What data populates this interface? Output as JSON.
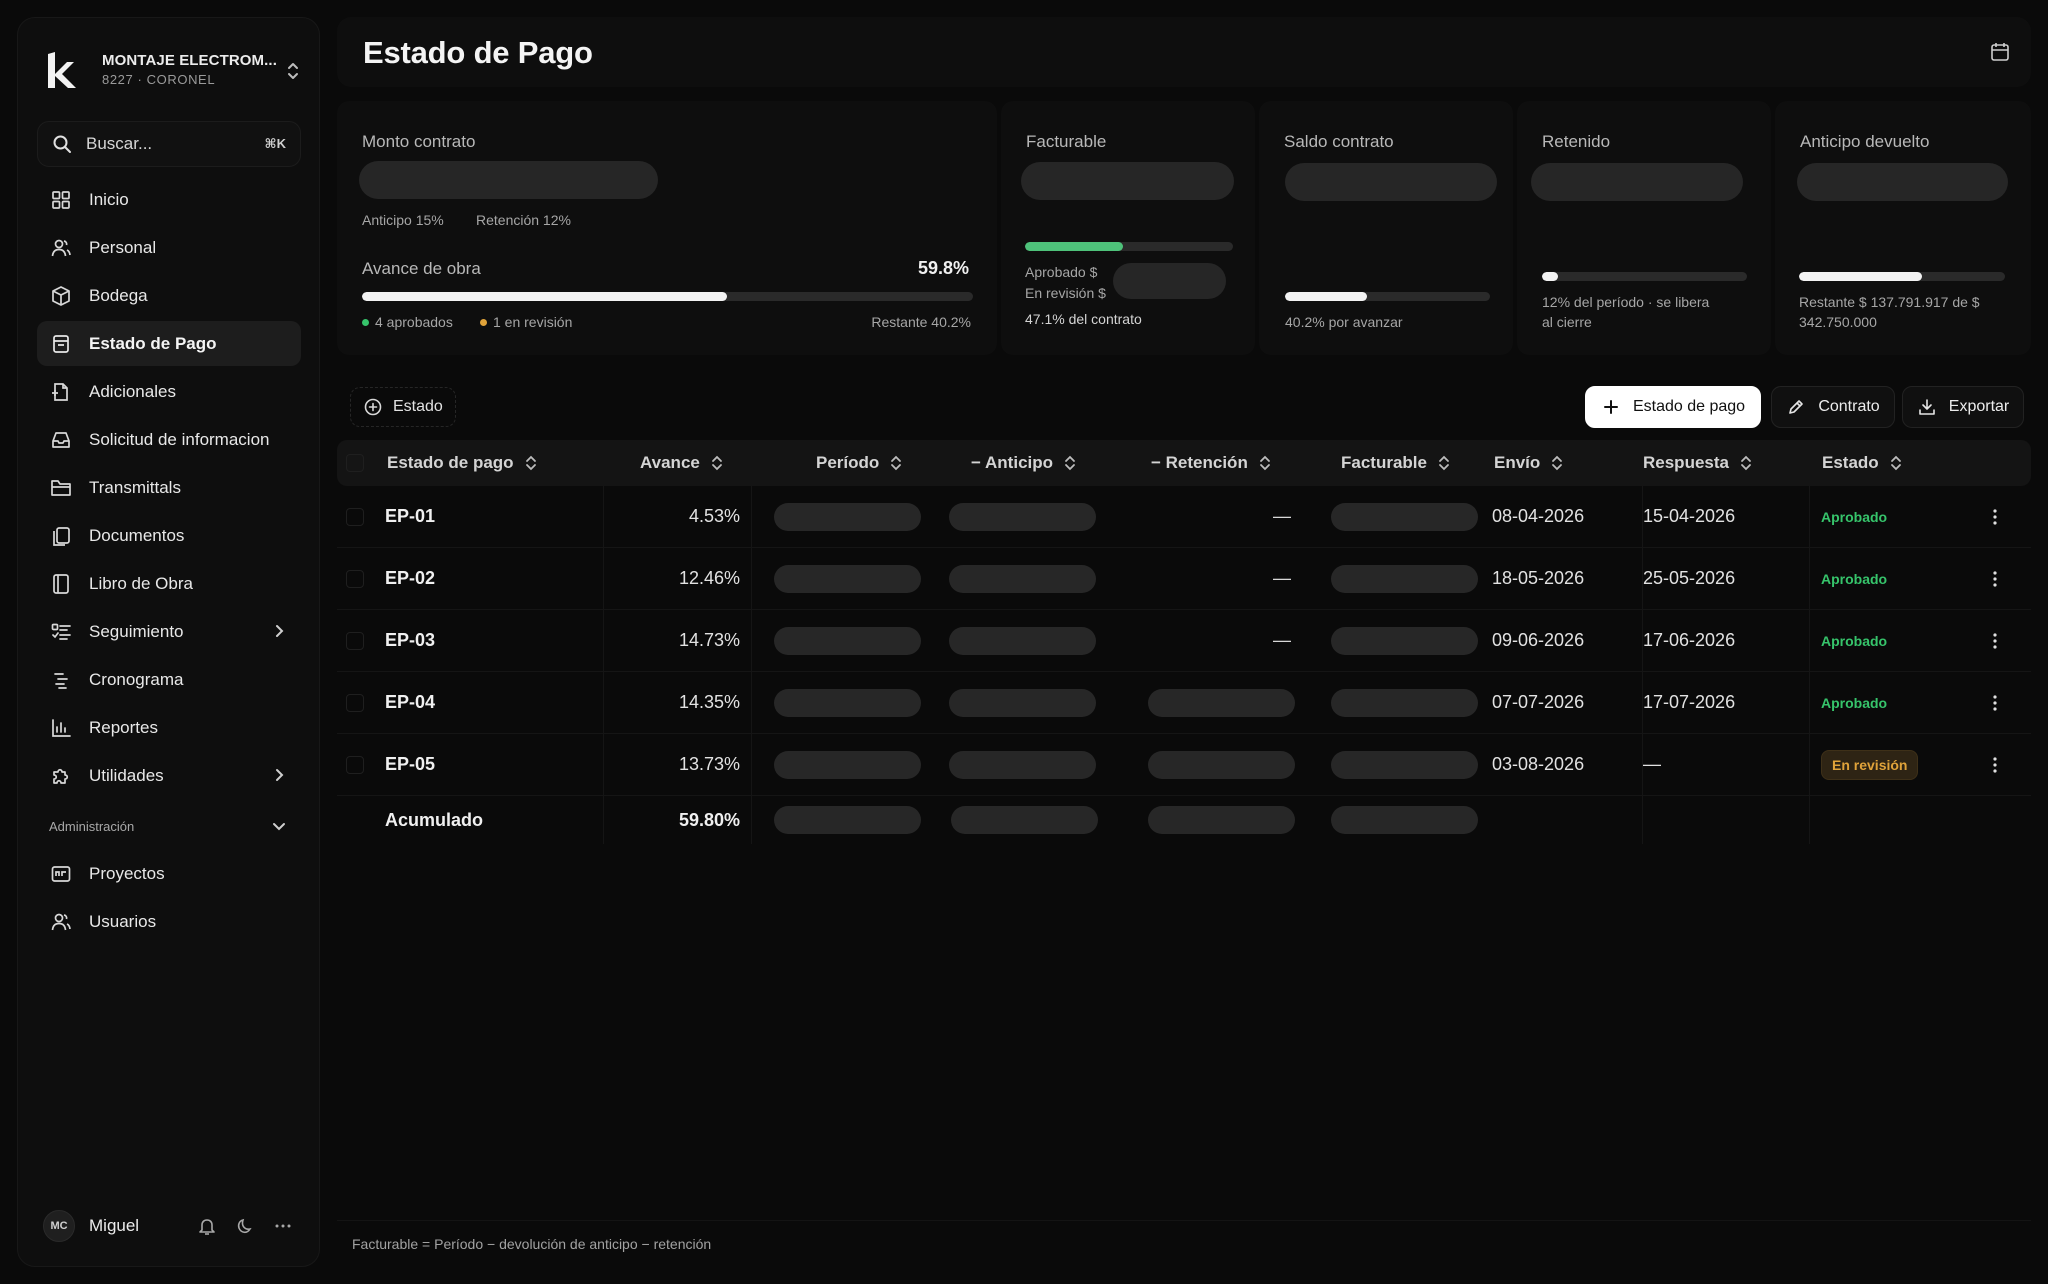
{
  "workspace": {
    "name": "MONTAJE ELECTROM...",
    "code": "8227 · CORONEL"
  },
  "search": {
    "placeholder": "Buscar...",
    "shortcut": "⌘K"
  },
  "sidebar": {
    "items": [
      {
        "label": "Inicio",
        "icon": "grid-icon"
      },
      {
        "label": "Personal",
        "icon": "users-icon"
      },
      {
        "label": "Bodega",
        "icon": "box-icon"
      },
      {
        "label": "Estado de Pago",
        "icon": "receipt-icon",
        "active": true
      },
      {
        "label": "Adicionales",
        "icon": "file-plus-icon"
      },
      {
        "label": "Solicitud de informacion",
        "icon": "inbox-icon"
      },
      {
        "label": "Transmittals",
        "icon": "folder-icon"
      },
      {
        "label": "Documentos",
        "icon": "documents-icon"
      },
      {
        "label": "Libro de Obra",
        "icon": "book-icon"
      },
      {
        "label": "Seguimiento",
        "icon": "list-check-icon",
        "expandable": true
      },
      {
        "label": "Cronograma",
        "icon": "timeline-icon"
      },
      {
        "label": "Reportes",
        "icon": "bar-chart-icon"
      },
      {
        "label": "Utilidades",
        "icon": "puzzle-icon",
        "expandable": true
      }
    ],
    "section_label": "Administración",
    "admin_items": [
      {
        "label": "Proyectos",
        "icon": "projects-icon"
      },
      {
        "label": "Usuarios",
        "icon": "users-icon"
      }
    ]
  },
  "user": {
    "initials": "MC",
    "name": "Miguel"
  },
  "header": {
    "title": "Estado de Pago"
  },
  "summary": {
    "monto": {
      "label": "Monto contrato",
      "anticipo": "Anticipo 15%",
      "retencion": "Retención 12%"
    },
    "avance": {
      "label": "Avance de obra",
      "value": "59.8%",
      "progress": 0.598,
      "aprobados": "4 aprobados",
      "revision": "1 en revisión",
      "restante": "Restante 40.2%"
    },
    "facturable": {
      "label": "Facturable",
      "progress": 0.471,
      "aprobado": "Aprobado $",
      "en_revision": "En revisión $",
      "pct": "47.1% del contrato"
    },
    "saldo": {
      "label": "Saldo contrato",
      "progress": 0.402,
      "note": "40.2% por avanzar"
    },
    "retenido": {
      "label": "Retenido",
      "progress": 0.08,
      "note1": "12% del período · se libera",
      "note2": "al cierre"
    },
    "anticipo_devuelto": {
      "label": "Anticipo devuelto",
      "progress": 0.598,
      "note1": "Restante $ 137.791.917 de $",
      "note2": "342.750.000"
    }
  },
  "toolbar": {
    "filter": "Estado",
    "new_ep": "Estado de pago",
    "contrato": "Contrato",
    "exportar": "Exportar"
  },
  "table": {
    "columns": [
      "Estado de pago",
      "Avance",
      "Período",
      "− Anticipo",
      "− Retención",
      "Facturable",
      "Envío",
      "Respuesta",
      "Estado"
    ],
    "rows": [
      {
        "ep": "EP-01",
        "avance": "4.53%",
        "retencion": "—",
        "envio": "08-04-2026",
        "respuesta": "15-04-2026",
        "estado": "Aprobado"
      },
      {
        "ep": "EP-02",
        "avance": "12.46%",
        "retencion": "—",
        "envio": "18-05-2026",
        "respuesta": "25-05-2026",
        "estado": "Aprobado"
      },
      {
        "ep": "EP-03",
        "avance": "14.73%",
        "retencion": "—",
        "envio": "09-06-2026",
        "respuesta": "17-06-2026",
        "estado": "Aprobado"
      },
      {
        "ep": "EP-04",
        "avance": "14.35%",
        "retencion": "",
        "envio": "07-07-2026",
        "respuesta": "17-07-2026",
        "estado": "Aprobado"
      },
      {
        "ep": "EP-05",
        "avance": "13.73%",
        "retencion": "",
        "envio": "03-08-2026",
        "respuesta": "—",
        "estado": "En revisión"
      }
    ],
    "total": {
      "label": "Acumulado",
      "avance": "59.80%"
    }
  },
  "footer": {
    "note": "Facturable = Período − devolución de anticipo − retención"
  },
  "colors": {
    "approved": "#36c46b",
    "review": "#e0a33a",
    "progress_green": "#4ec27a"
  }
}
